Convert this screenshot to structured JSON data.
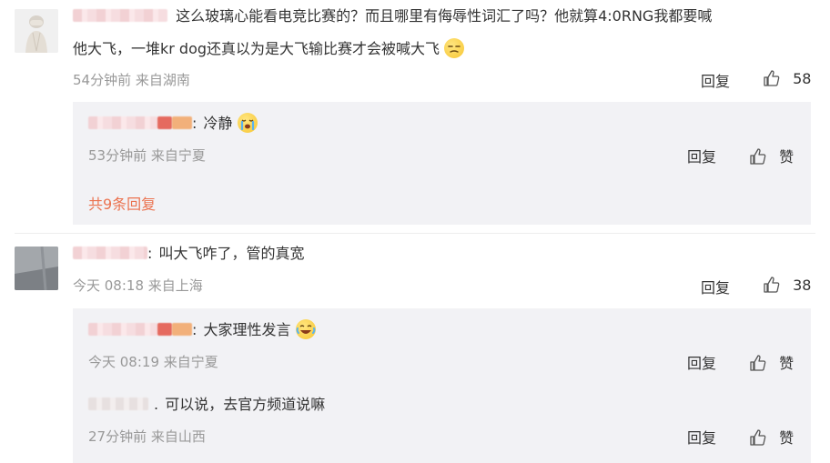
{
  "comments": [
    {
      "text_line1": "这么玻璃心能看电竞比赛的？而且哪里有侮辱性词汇了吗？他就算4:0RNG我都要喊",
      "text_line2": "他大飞，一堆kr dog还真以为是大飞输比赛才会被喊大飞",
      "meta": "54分钟前 来自湖南",
      "reply_label": "回复",
      "like_count": "58",
      "emoji_end": "smirk-emoji",
      "replies": [
        {
          "separator": ":",
          "text": "冷静",
          "emoji": "crying-emoji",
          "meta": "53分钟前 来自宁夏",
          "reply_label": "回复",
          "like_label": "赞"
        }
      ],
      "total_replies": "共9条回复"
    },
    {
      "separator": ":",
      "text": "叫大飞咋了，管的真宽",
      "meta": "今天 08:18 来自上海",
      "reply_label": "回复",
      "like_count": "38",
      "replies": [
        {
          "separator": ":",
          "text": "大家理性发言",
          "emoji": "laughing-tears-emoji",
          "meta": "今天 08:19 来自宁夏",
          "reply_label": "回复",
          "like_label": "赞"
        },
        {
          "separator": ".",
          "text": "可以说，去官方频道说嘛",
          "meta": "27分钟前 来自山西",
          "reply_label": "回复",
          "like_label": "赞"
        }
      ]
    }
  ],
  "colors": {
    "meta": "#999999",
    "link": "#eb7350",
    "reply_bg": "#f2f2f5"
  }
}
